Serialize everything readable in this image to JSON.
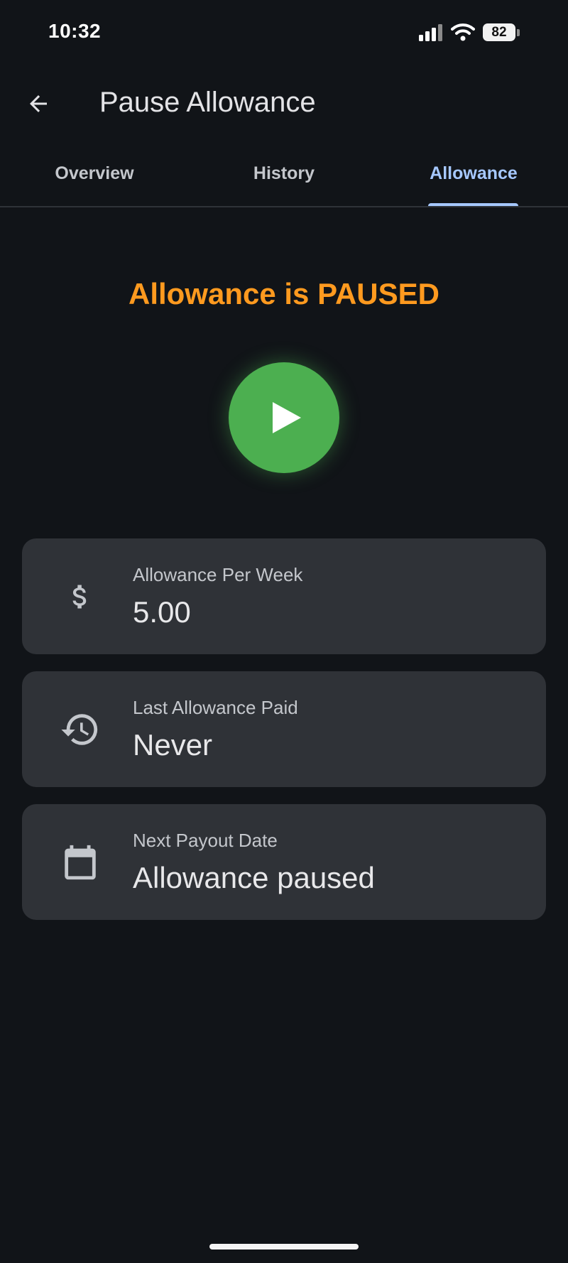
{
  "status_bar": {
    "time": "10:32",
    "battery_level": "82",
    "icons": [
      "signal-icon",
      "wifi-icon",
      "battery-icon"
    ]
  },
  "app_bar": {
    "title": "Pause Allowance",
    "back_icon": "arrow-back-icon"
  },
  "tabs": [
    {
      "label": "Overview",
      "active": false
    },
    {
      "label": "History",
      "active": false
    },
    {
      "label": "Allowance",
      "active": true
    }
  ],
  "status": {
    "heading": "Allowance is PAUSED",
    "action_icon": "play-icon"
  },
  "cards": [
    {
      "icon": "dollar-icon",
      "label": "Allowance Per Week",
      "value": "5.00"
    },
    {
      "icon": "history-icon",
      "label": "Last Allowance Paid",
      "value": "Never"
    },
    {
      "icon": "calendar-icon",
      "label": "Next Payout Date",
      "value": "Allowance paused"
    }
  ],
  "colors": {
    "background": "#111418",
    "accent": "#a6c8ff",
    "paused": "#ff9a1f",
    "play": "#4caf50",
    "card": "#2f3237"
  }
}
